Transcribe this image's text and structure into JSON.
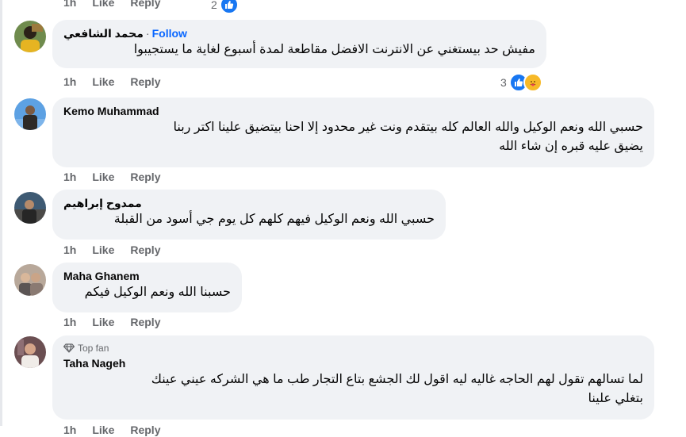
{
  "top_actions": {
    "time": "1h",
    "like": "Like",
    "reply": "Reply",
    "reaction_count": "2"
  },
  "comments": [
    {
      "author": "محمد الشافعي",
      "follow": "Follow",
      "text_lines": [
        "مفيش حد بيستغني عن الانترنت الافضل مقاطعة لمدة أسبوع لغاية ما يستجيبوا"
      ],
      "time": "1h",
      "like": "Like",
      "reply": "Reply",
      "reaction_count": "3",
      "reactions": [
        "like-icon",
        "care-icon"
      ]
    },
    {
      "author": "Kemo Muhammad",
      "text_lines": [
        "حسبي الله ونعم الوكيل والله العالم كله بيتقدم ونت غير محدود إلا احنا بيتضيق علينا اكتر ربنا",
        "يضيق عليه قبره إن شاء الله"
      ],
      "time": "1h",
      "like": "Like",
      "reply": "Reply"
    },
    {
      "author": "ممدوح إبراهيم",
      "text_lines": [
        "حسبي الله ونعم الوكيل فيهم كلهم كل يوم جي أسود من القبلة"
      ],
      "time": "1h",
      "like": "Like",
      "reply": "Reply"
    },
    {
      "author": "Maha Ghanem",
      "text_lines": [
        "حسبنا الله ونعم الوكيل فيكم"
      ],
      "time": "1h",
      "like": "Like",
      "reply": "Reply"
    },
    {
      "badge": "Top fan",
      "author": "Taha Nageh",
      "text_lines": [
        "لما تسالهم تقول لهم الحاجه غاليه ليه اقول لك الجشع بتاع التجار طب ما هي الشركه عيني عينك",
        "بتغلي علينا"
      ],
      "time": "1h",
      "like": "Like",
      "reply": "Reply"
    }
  ],
  "colors": {
    "bubble": "#f0f2f5",
    "secondary_text": "#65676b",
    "follow": "#0866ff",
    "like_reaction": "#1877f2"
  }
}
